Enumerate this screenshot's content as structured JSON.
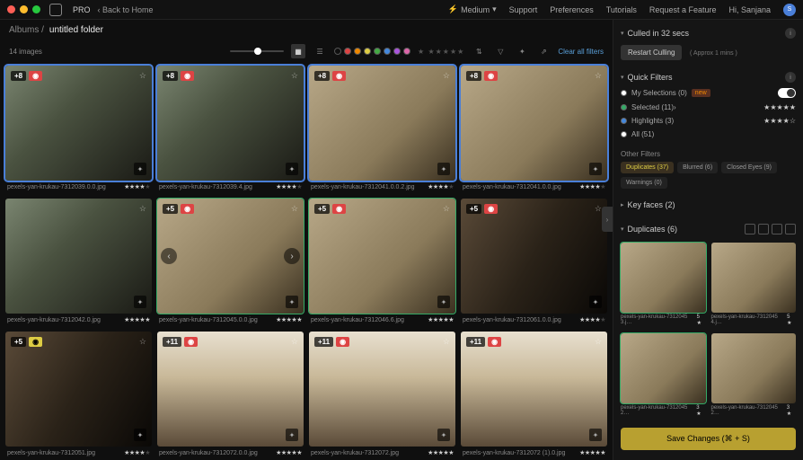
{
  "topbar": {
    "pro": "PRO",
    "back": "‹  Back to Home",
    "speed": "Medium",
    "links": [
      "Support",
      "Preferences",
      "Tutorials",
      "Request a Feature"
    ],
    "greeting": "Hi, Sanjana",
    "avatar_initial": "S"
  },
  "breadcrumb": {
    "albums": "Albums  /",
    "folder": "untitled folder"
  },
  "toolbar": {
    "count": "14 images",
    "clear": "Clear all filters"
  },
  "grid": [
    {
      "badge": "+8",
      "color": "red",
      "file": "pexels-yan-krukau-7312039.0.0.jpg",
      "rating": 4,
      "sel": true,
      "img": "a"
    },
    {
      "badge": "+8",
      "color": "red",
      "file": "pexels-yan-krukau-7312039.4.jpg",
      "rating": 4,
      "sel": true,
      "img": "a"
    },
    {
      "badge": "+8",
      "color": "red",
      "file": "pexels-yan-krukau-7312041.0.0.2.jpg",
      "rating": 4,
      "sel": true,
      "img": "b"
    },
    {
      "badge": "+8",
      "color": "red",
      "file": "pexels-yan-krukau-7312041.0.0.jpg",
      "rating": 4,
      "sel": true,
      "img": "b"
    },
    {
      "badge": "",
      "color": "",
      "file": "pexels-yan-krukau-7312042.0.jpg",
      "rating": 5,
      "img": "a"
    },
    {
      "badge": "+5",
      "color": "red",
      "file": "pexels-yan-krukau-7312045.0.0.jpg",
      "rating": 5,
      "nav": true,
      "img": "b",
      "grn": true
    },
    {
      "badge": "+5",
      "color": "red",
      "file": "pexels-yan-krukau-7312046.6.jpg",
      "rating": 5,
      "img": "b",
      "grn": true
    },
    {
      "badge": "+5",
      "color": "red",
      "file": "pexels-yan-krukau-7312061.0.0.jpg",
      "rating": 4,
      "img": "c"
    },
    {
      "badge": "+5",
      "color": "yellow",
      "file": "pexels-yan-krukau-7312051.jpg",
      "rating": 4,
      "img": "c"
    },
    {
      "badge": "+11",
      "color": "red",
      "file": "pexels-yan-krukau-7312072.0.0.jpg",
      "rating": 5,
      "img": "d"
    },
    {
      "badge": "+11",
      "color": "red",
      "file": "pexels-yan-krukau-7312072.jpg",
      "rating": 5,
      "img": "d"
    },
    {
      "badge": "+11",
      "color": "red",
      "file": "pexels-yan-krukau-7312072 (1).0.jpg",
      "rating": 5,
      "img": "d"
    }
  ],
  "culled": {
    "title": "Culled in 32 secs",
    "restart": "Restart Culling",
    "approx": "( Approx 1 mins )"
  },
  "quick": {
    "title": "Quick Filters",
    "rows": [
      {
        "dot": "white",
        "label": "My Selections (0)",
        "tag": "new",
        "toggle": true
      },
      {
        "dot": "green",
        "label": "Selected (11)",
        "suffix": "›",
        "stars": "★★★★★"
      },
      {
        "dot": "blue",
        "label": "Highlights (3)",
        "stars": "★★★★☆"
      },
      {
        "dot": "white",
        "label": "All (51)"
      }
    ]
  },
  "other": {
    "title": "Other Filters",
    "pills": [
      {
        "label": "Duplicates (37)",
        "active": true
      },
      {
        "label": "Blurred (6)"
      },
      {
        "label": "Closed Eyes (9)"
      },
      {
        "label": "Warnings (0)"
      }
    ]
  },
  "keyfaces": {
    "title": "Key faces (2)"
  },
  "duplicates": {
    "title": "Duplicates (6)",
    "items": [
      {
        "file": "pexels-yan-krukau-7312045 3.j…",
        "stars": "5 ★",
        "sel": true,
        "img": "b"
      },
      {
        "file": "pexels-yan-krukau-7312045 4.j…",
        "stars": "5 ★",
        "img": "b"
      },
      {
        "file": "pexels-yan-krukau-7312045 2…",
        "stars": "3 ★",
        "sel": true,
        "img": "b"
      },
      {
        "file": "pexels-yan-krukau-7312045 2…",
        "stars": "3 ★",
        "img": "b"
      }
    ]
  },
  "save": "Save Changes (⌘ + S)"
}
